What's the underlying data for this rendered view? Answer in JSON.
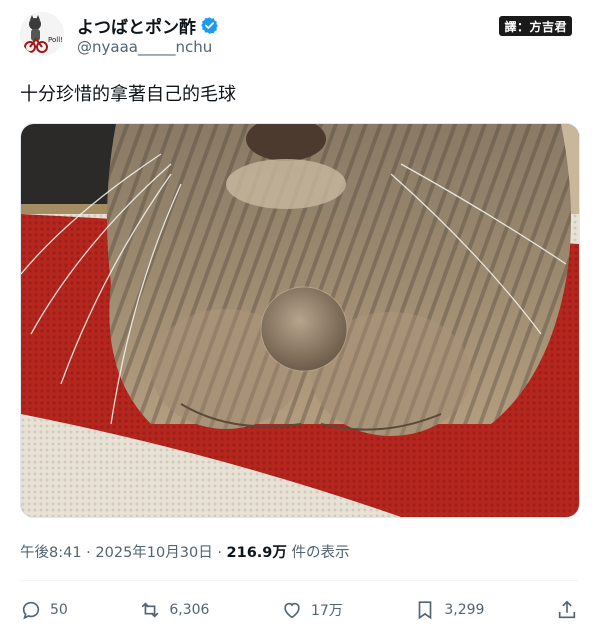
{
  "author": {
    "display_name": "よつばとポン酢",
    "handle": "@nyaaa_____nchu",
    "avatar_caption": "Poll!",
    "verified": true
  },
  "translator_badge": "譯：方吉君",
  "tweet": {
    "text": "十分珍惜的拿著自己的毛球",
    "time": "午後8:41",
    "date": "2025年10月30日",
    "views_count": "216.9万",
    "views_label": "件の表示"
  },
  "actions": {
    "replies": "50",
    "reposts": "6,306",
    "likes": "17万",
    "bookmarks": "3,299"
  },
  "colors": {
    "verified": "#1d9bf0",
    "text": "#0f1419",
    "secondary": "#536471"
  },
  "icons": [
    "verified-icon",
    "reply-icon",
    "repost-icon",
    "like-icon",
    "bookmark-icon",
    "share-icon"
  ]
}
